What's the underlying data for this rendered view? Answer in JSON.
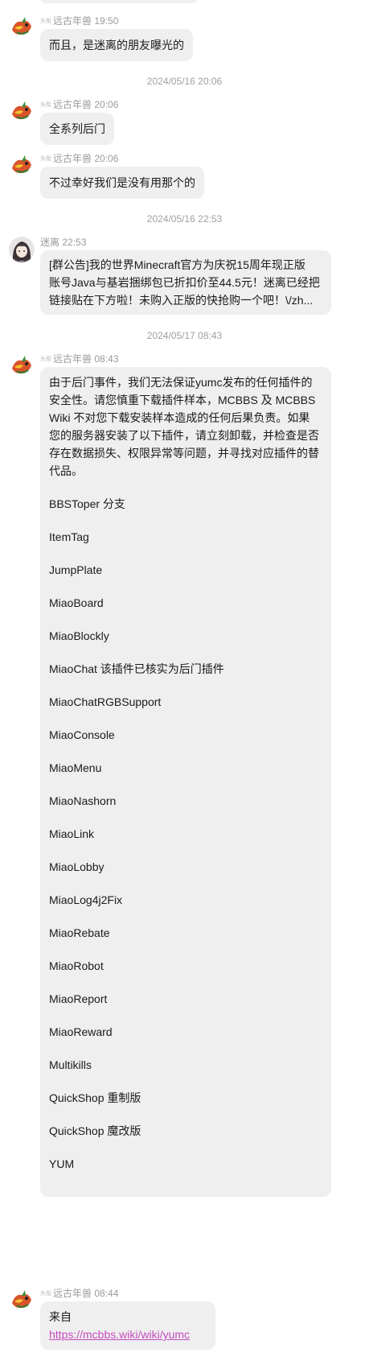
{
  "sender_title_tag": "头衔",
  "messages": [
    {
      "sender": "远古年兽",
      "time": "19:50",
      "text": "而且，是迷离的朋友曝光的"
    },
    {
      "separator": "2024/05/16 20:06"
    },
    {
      "sender": "远古年兽",
      "time": "20:06",
      "text": "全系列后门"
    },
    {
      "sender": "远古年兽",
      "time": "20:06",
      "text": "不过幸好我们是没有用那个的"
    },
    {
      "separator": "2024/05/16 22:53"
    },
    {
      "sender": "迷离",
      "time": "22:53",
      "lines": [
        "[群公告]我的世界Minecraft官方为庆祝15周年现正版",
        "账号Java与基岩捆绑包已折扣价至44.5元！迷离已经把",
        "链接贴在下方啦！未购入正版的快抢购一个吧！\\/zh..."
      ]
    },
    {
      "separator": "2024/05/17 08:43"
    },
    {
      "sender": "远古年兽",
      "time": "08:43",
      "intro_lines": [
        "由于后门事件，我们无法保证yumc发布的任何插件的",
        "安全性。请您慎重下载插件样本，MCBBS 及 MCBBS",
        "Wiki 不对您下载安装样本造成的任何后果负责。如果",
        "您的服务器安装了以下插件，请立刻卸载，并检查是否",
        "存在数据损失、权限异常等问题，并寻找对应插件的替",
        "代品。"
      ],
      "plugins": [
        "BBSToper 分支",
        "ItemTag",
        "JumpPlate",
        "MiaoBoard",
        "MiaoBlockly",
        "MiaoChat 该插件已核实为后门插件",
        "MiaoChatRGBSupport",
        "MiaoConsole",
        "MiaoMenu",
        "MiaoNashorn",
        "MiaoLink",
        "MiaoLobby",
        "MiaoLog4j2Fix",
        "MiaoRebate",
        "MiaoRobot",
        "MiaoReport",
        "MiaoReward",
        "Multikills",
        "QuickShop 重制版",
        "QuickShop 魔改版",
        "YUM"
      ]
    },
    {
      "sender": "远古年兽",
      "time": "08:44",
      "text": "来自",
      "link": "https://mcbbs.wiki/wiki/yumc"
    }
  ],
  "colors": {
    "bubble": "#efefef",
    "meta_text": "#9a9a9a",
    "link": "#c44bbf"
  },
  "icons": [
    "dragon-avatar-icon",
    "anime-girl-avatar-icon"
  ]
}
